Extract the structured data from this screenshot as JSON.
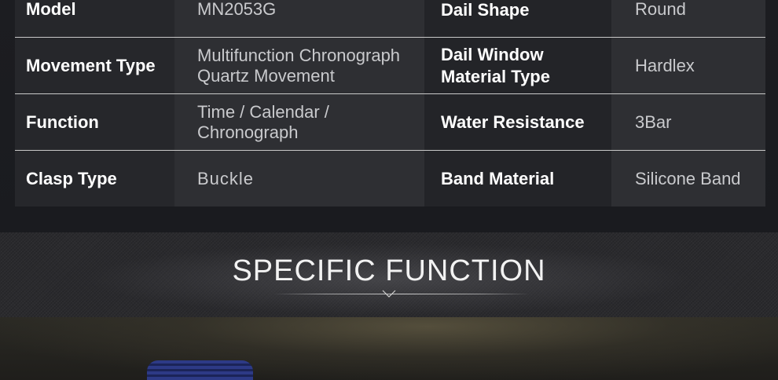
{
  "specs": {
    "rows": [
      {
        "key1": "Model",
        "val1": "MN2053G",
        "key2": "Dail Shape",
        "val2": "Round"
      },
      {
        "key1": "Movement Type",
        "val1": "Multifunction Chronograph Quartz Movement",
        "key2": "Dail Window Material Type",
        "val2": "Hardlex"
      },
      {
        "key1": "Function",
        "val1": "Time  / Calendar / Chronograph",
        "key2": "Water Resistance",
        "val2": "3Bar"
      },
      {
        "key1": "Clasp Type",
        "val1": "Buckle",
        "key2": "Band Material",
        "val2": "Silicone Band"
      }
    ]
  },
  "banner": {
    "title": "SPECIFIC FUNCTION"
  },
  "colors": {
    "text_key": "#ffffff",
    "text_value": "#c9cacd",
    "divider": "#c9c9c9",
    "watch_strap": "#2d3a86"
  }
}
